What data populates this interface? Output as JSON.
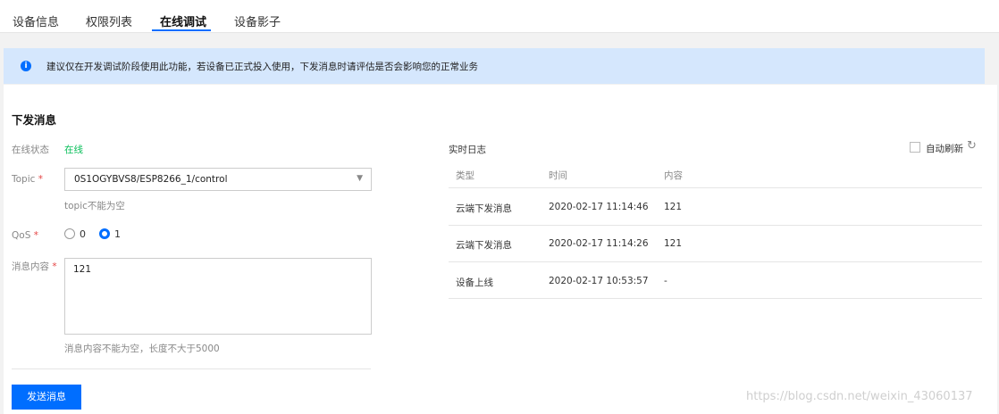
{
  "tabs": [
    {
      "label": "设备信息"
    },
    {
      "label": "权限列表"
    },
    {
      "label": "在线调试"
    },
    {
      "label": "设备影子"
    }
  ],
  "banner": {
    "icon": "info-icon",
    "text": "建议仅在开发调试阶段使用此功能，若设备已正式投入使用，下发消息时请评估是否会影响您的正常业务"
  },
  "form": {
    "title": "下发消息",
    "status_label": "在线状态",
    "status_value": "在线",
    "topic_label": "Topic",
    "topic_value": "0S1OGYBVS8/ESP8266_1/control",
    "topic_help": "topic不能为空",
    "qos_label": "QoS",
    "qos_options": [
      "0",
      "1"
    ],
    "qos_selected": "1",
    "message_label": "消息内容",
    "message_value": "121",
    "message_help": "消息内容不能为空，长度不大于5000",
    "required_mark": "*",
    "send_button": "发送消息"
  },
  "log": {
    "title": "实时日志",
    "auto_refresh_label": "自动刷新",
    "headers": [
      "类型",
      "时间",
      "内容"
    ],
    "rows": [
      {
        "type": "云端下发消息",
        "time": "2020-02-17 11:14:46",
        "content": "121"
      },
      {
        "type": "云端下发消息",
        "time": "2020-02-17 11:14:26",
        "content": "121"
      },
      {
        "type": "设备上线",
        "time": "2020-02-17 10:53:57",
        "content": "-"
      }
    ]
  },
  "watermark": "https://blog.csdn.net/weixin_43060137",
  "colors": {
    "accent": "#006eff",
    "online": "#0abf5b",
    "banner_bg": "#d5e7fd",
    "required": "#e54545"
  }
}
